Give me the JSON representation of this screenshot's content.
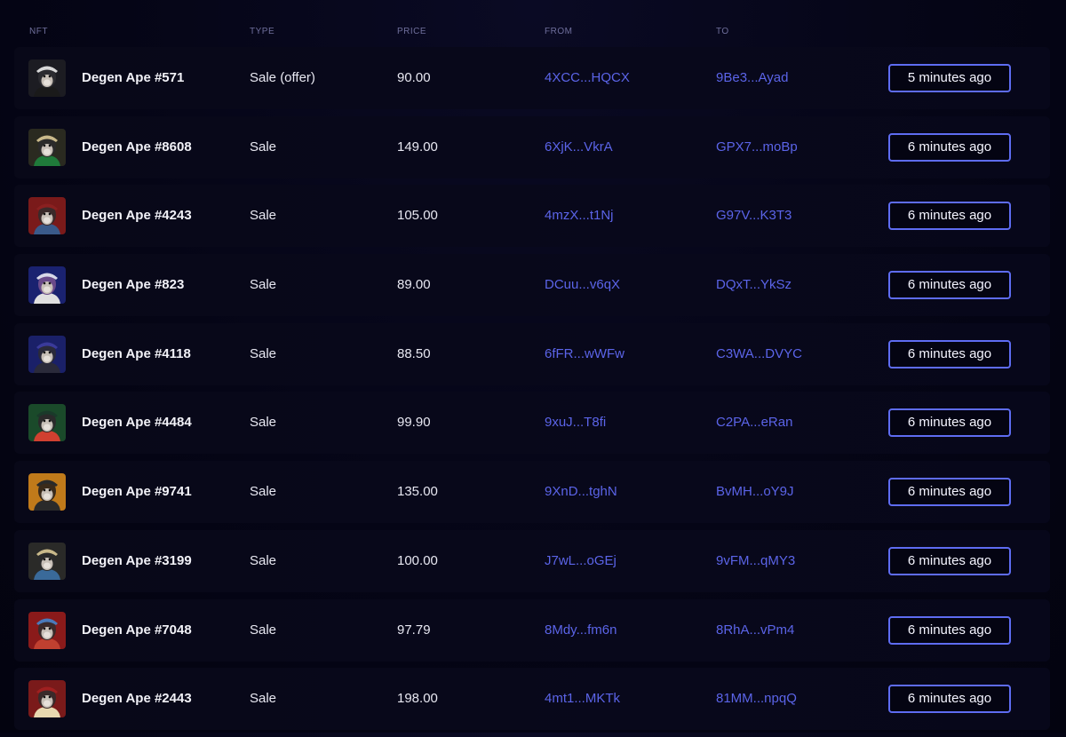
{
  "table": {
    "headers": {
      "nft": "NFT",
      "type": "TYPE",
      "price": "PRICE",
      "from": "FROM",
      "to": "TO"
    },
    "rows": [
      {
        "name": "Degen Ape #571",
        "type": "Sale (offer)",
        "price": "90.00",
        "from": "4XCC...HQCX",
        "to": "9Be3...Ayad",
        "time": "5 minutes ago",
        "avatar_bg": "#1c1c22",
        "avatar_fur": "#2b2b30",
        "avatar_hat": "#d8d8d8",
        "avatar_shirt": "#1a1a1a"
      },
      {
        "name": "Degen Ape #8608",
        "type": "Sale",
        "price": "149.00",
        "from": "6XjK...VkrA",
        "to": "GPX7...moBp",
        "time": "6 minutes ago",
        "avatar_bg": "#2a2a20",
        "avatar_fur": "#2a2a2a",
        "avatar_hat": "#c9b98a",
        "avatar_shirt": "#1f7a3a"
      },
      {
        "name": "Degen Ape #4243",
        "type": "Sale",
        "price": "105.00",
        "from": "4mzX...t1Nj",
        "to": "G97V...K3T3",
        "time": "6 minutes ago",
        "avatar_bg": "#7a1a1a",
        "avatar_fur": "#3a2a2a",
        "avatar_hat": "#8a2020",
        "avatar_shirt": "#3a5a8a"
      },
      {
        "name": "Degen Ape #823",
        "type": "Sale",
        "price": "89.00",
        "from": "DCuu...v6qX",
        "to": "DQxT...YkSz",
        "time": "6 minutes ago",
        "avatar_bg": "#1a2270",
        "avatar_fur": "#6a4a8a",
        "avatar_hat": "#d8d8e8",
        "avatar_shirt": "#e0e0e0"
      },
      {
        "name": "Degen Ape #4118",
        "type": "Sale",
        "price": "88.50",
        "from": "6fFR...wWFw",
        "to": "C3WA...DVYC",
        "time": "6 minutes ago",
        "avatar_bg": "#1a2068",
        "avatar_fur": "#2a2a3a",
        "avatar_hat": "#3a3a9a",
        "avatar_shirt": "#2a2a3a"
      },
      {
        "name": "Degen Ape #4484",
        "type": "Sale",
        "price": "99.90",
        "from": "9xuJ...T8fi",
        "to": "C2PA...eRan",
        "time": "6 minutes ago",
        "avatar_bg": "#1a4a2a",
        "avatar_fur": "#2a2a2a",
        "avatar_hat": "#1a3a2a",
        "avatar_shirt": "#d04030"
      },
      {
        "name": "Degen Ape #9741",
        "type": "Sale",
        "price": "135.00",
        "from": "9XnD...tghN",
        "to": "BvMH...oY9J",
        "time": "6 minutes ago",
        "avatar_bg": "#c07a1a",
        "avatar_fur": "#3a2a1a",
        "avatar_hat": "#2a2a2a",
        "avatar_shirt": "#2a2a2a"
      },
      {
        "name": "Degen Ape #3199",
        "type": "Sale",
        "price": "100.00",
        "from": "J7wL...oGEj",
        "to": "9vFM...qMY3",
        "time": "6 minutes ago",
        "avatar_bg": "#2a2a28",
        "avatar_fur": "#2a2a2a",
        "avatar_hat": "#c9b98a",
        "avatar_shirt": "#3a6a9a"
      },
      {
        "name": "Degen Ape #7048",
        "type": "Sale",
        "price": "97.79",
        "from": "8Mdy...fm6n",
        "to": "8RhA...vPm4",
        "time": "6 minutes ago",
        "avatar_bg": "#8a1a1a",
        "avatar_fur": "#3a2a2a",
        "avatar_hat": "#4a7aba",
        "avatar_shirt": "#c04030"
      },
      {
        "name": "Degen Ape #2443",
        "type": "Sale",
        "price": "198.00",
        "from": "4mt1...MKTk",
        "to": "81MM...npqQ",
        "time": "6 minutes ago",
        "avatar_bg": "#7a1a1a",
        "avatar_fur": "#3a2a2a",
        "avatar_hat": "#a02020",
        "avatar_shirt": "#e8d8b0"
      }
    ]
  }
}
